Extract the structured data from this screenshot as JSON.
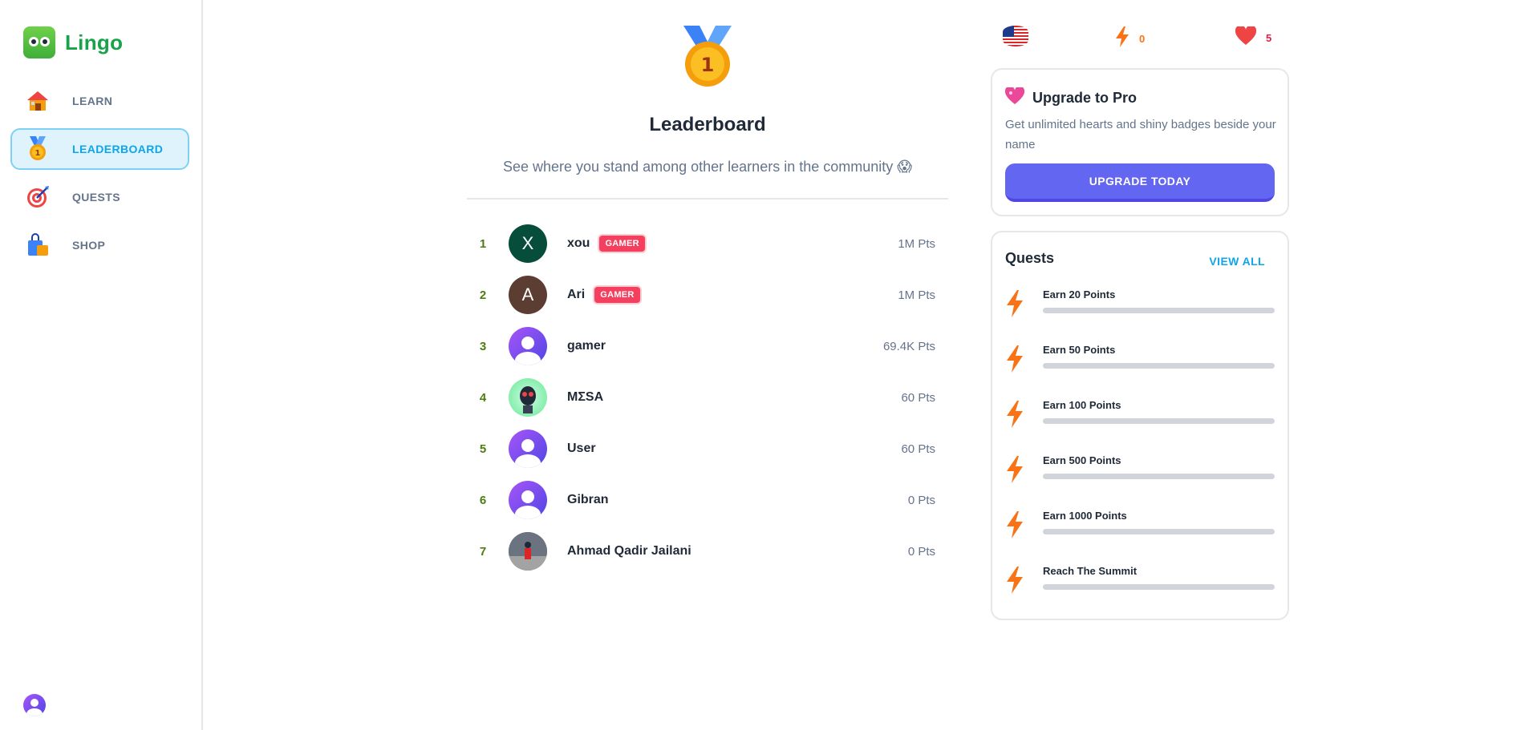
{
  "app": {
    "name": "Lingo"
  },
  "sidebar": {
    "items": [
      {
        "label": "LEARN",
        "icon": "house-icon",
        "active": false
      },
      {
        "label": "LEADERBOARD",
        "icon": "medal-icon",
        "active": true
      },
      {
        "label": "QUESTS",
        "icon": "target-icon",
        "active": false
      },
      {
        "label": "SHOP",
        "icon": "shopping-bag-icon",
        "active": false
      }
    ]
  },
  "main": {
    "title": "Leaderboard",
    "subtitle": "See where you stand among other learners in the community 😱",
    "leaderboard": [
      {
        "rank": "1",
        "name": "xou",
        "badge": "GAMER",
        "points": "1M Pts",
        "avatar": "X"
      },
      {
        "rank": "2",
        "name": "Ari",
        "badge": "GAMER",
        "points": "1M Pts",
        "avatar": "A"
      },
      {
        "rank": "3",
        "name": "gamer",
        "badge": "",
        "points": "69.4K Pts",
        "avatar": ""
      },
      {
        "rank": "4",
        "name": "MΣSA",
        "badge": "",
        "points": "60 Pts",
        "avatar": ""
      },
      {
        "rank": "5",
        "name": "User",
        "badge": "",
        "points": "60 Pts",
        "avatar": ""
      },
      {
        "rank": "6",
        "name": "Gibran",
        "badge": "",
        "points": "0 Pts",
        "avatar": ""
      },
      {
        "rank": "7",
        "name": "Ahmad Qadir Jailani",
        "badge": "",
        "points": "0 Pts",
        "avatar": ""
      }
    ]
  },
  "topbar": {
    "language": "flag-us-icon",
    "streak": "0",
    "hearts": "5"
  },
  "pro": {
    "title": "Upgrade to Pro",
    "description": "Get unlimited hearts and shiny badges beside your name",
    "button": "UPGRADE TODAY"
  },
  "quests": {
    "title": "Quests",
    "view_all": "VIEW ALL",
    "items": [
      {
        "name": "Earn 20 Points",
        "progress": 0
      },
      {
        "name": "Earn 50 Points",
        "progress": 0
      },
      {
        "name": "Earn 100 Points",
        "progress": 0
      },
      {
        "name": "Earn 500 Points",
        "progress": 0
      },
      {
        "name": "Earn 1000 Points",
        "progress": 0
      },
      {
        "name": "Reach The Summit",
        "progress": 0
      }
    ]
  },
  "colors": {
    "brand": "#16a34a",
    "accent": "#0ea5e9",
    "button": "#6366f1",
    "badge": "#f43f5e"
  }
}
